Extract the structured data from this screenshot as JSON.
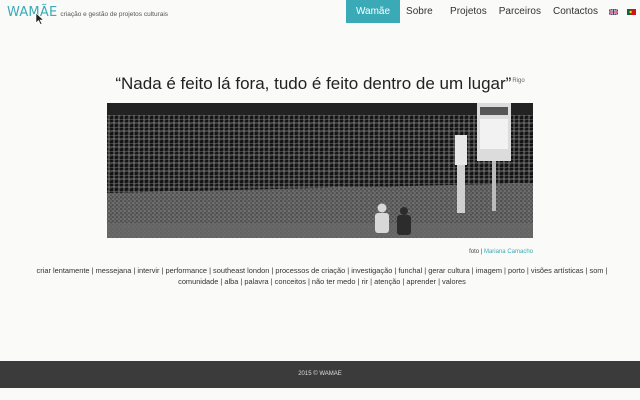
{
  "brand": {
    "name": "WAMÃE",
    "tagline": "criação e gestão de projetos culturais"
  },
  "nav": {
    "items": [
      {
        "label": "Wamãe",
        "active": true
      },
      {
        "label": "Sobre",
        "active": false
      },
      {
        "label": "Projetos",
        "active": false
      },
      {
        "label": "Parceiros",
        "active": false
      },
      {
        "label": "Contactos",
        "active": false
      }
    ],
    "flags": [
      "english-flag-icon",
      "portuguese-flag-icon"
    ]
  },
  "quote": {
    "text": "“Nada é feito lá fora, tudo é feito dentro de um lugar”",
    "author": "Rigo"
  },
  "photo": {
    "credit_prefix": "foto | ",
    "credit_name": "Mariana Camacho"
  },
  "tags": "criar lentamente | messejana | intervir | performance | southeast london | processos de criação | investigação | funchal | gerar cultura | imagem | porto | visões artísticas | som | comunidade | alba | palavra | conceitos | não ter medo | rir | atenção | aprender | valores",
  "footer": {
    "text": "2015 © WAMAE"
  },
  "colors": {
    "accent": "#3aaab7",
    "footer_bg": "#3b3b3b"
  }
}
